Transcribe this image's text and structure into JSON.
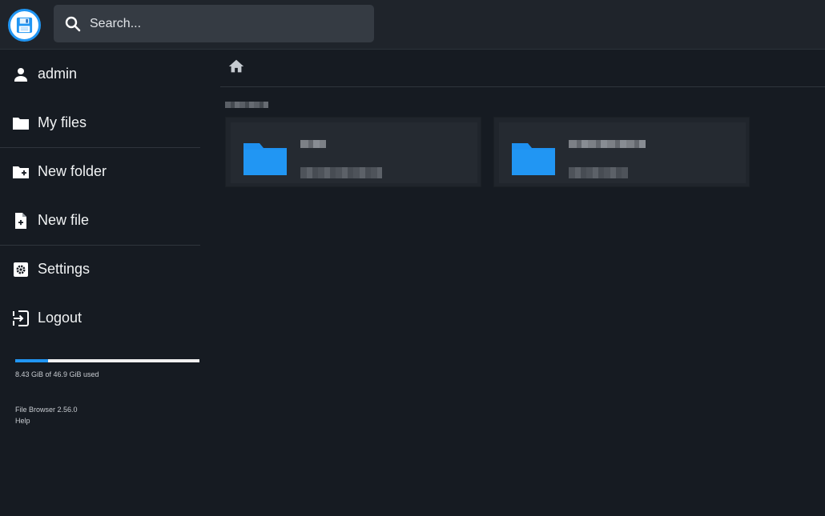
{
  "header": {
    "search": {
      "placeholder": "Search..."
    }
  },
  "sidebar": {
    "items": [
      {
        "label": "admin",
        "icon": "person-icon"
      },
      {
        "label": "My files",
        "icon": "folder-icon"
      },
      {
        "label": "New folder",
        "icon": "create-new-folder-icon"
      },
      {
        "label": "New file",
        "icon": "note-add-icon"
      },
      {
        "label": "Settings",
        "icon": "settings-icon"
      },
      {
        "label": "Logout",
        "icon": "logout-icon"
      }
    ],
    "usage": {
      "text": "8.43 GiB of 46.9 GiB used",
      "used_fraction": 0.18
    },
    "credits": {
      "version": "File Browser 2.56.0",
      "help": "Help"
    }
  },
  "colors": {
    "accent": "#2196f3",
    "background": "#161b22",
    "header": "#1f242b",
    "card": "#252a31"
  }
}
